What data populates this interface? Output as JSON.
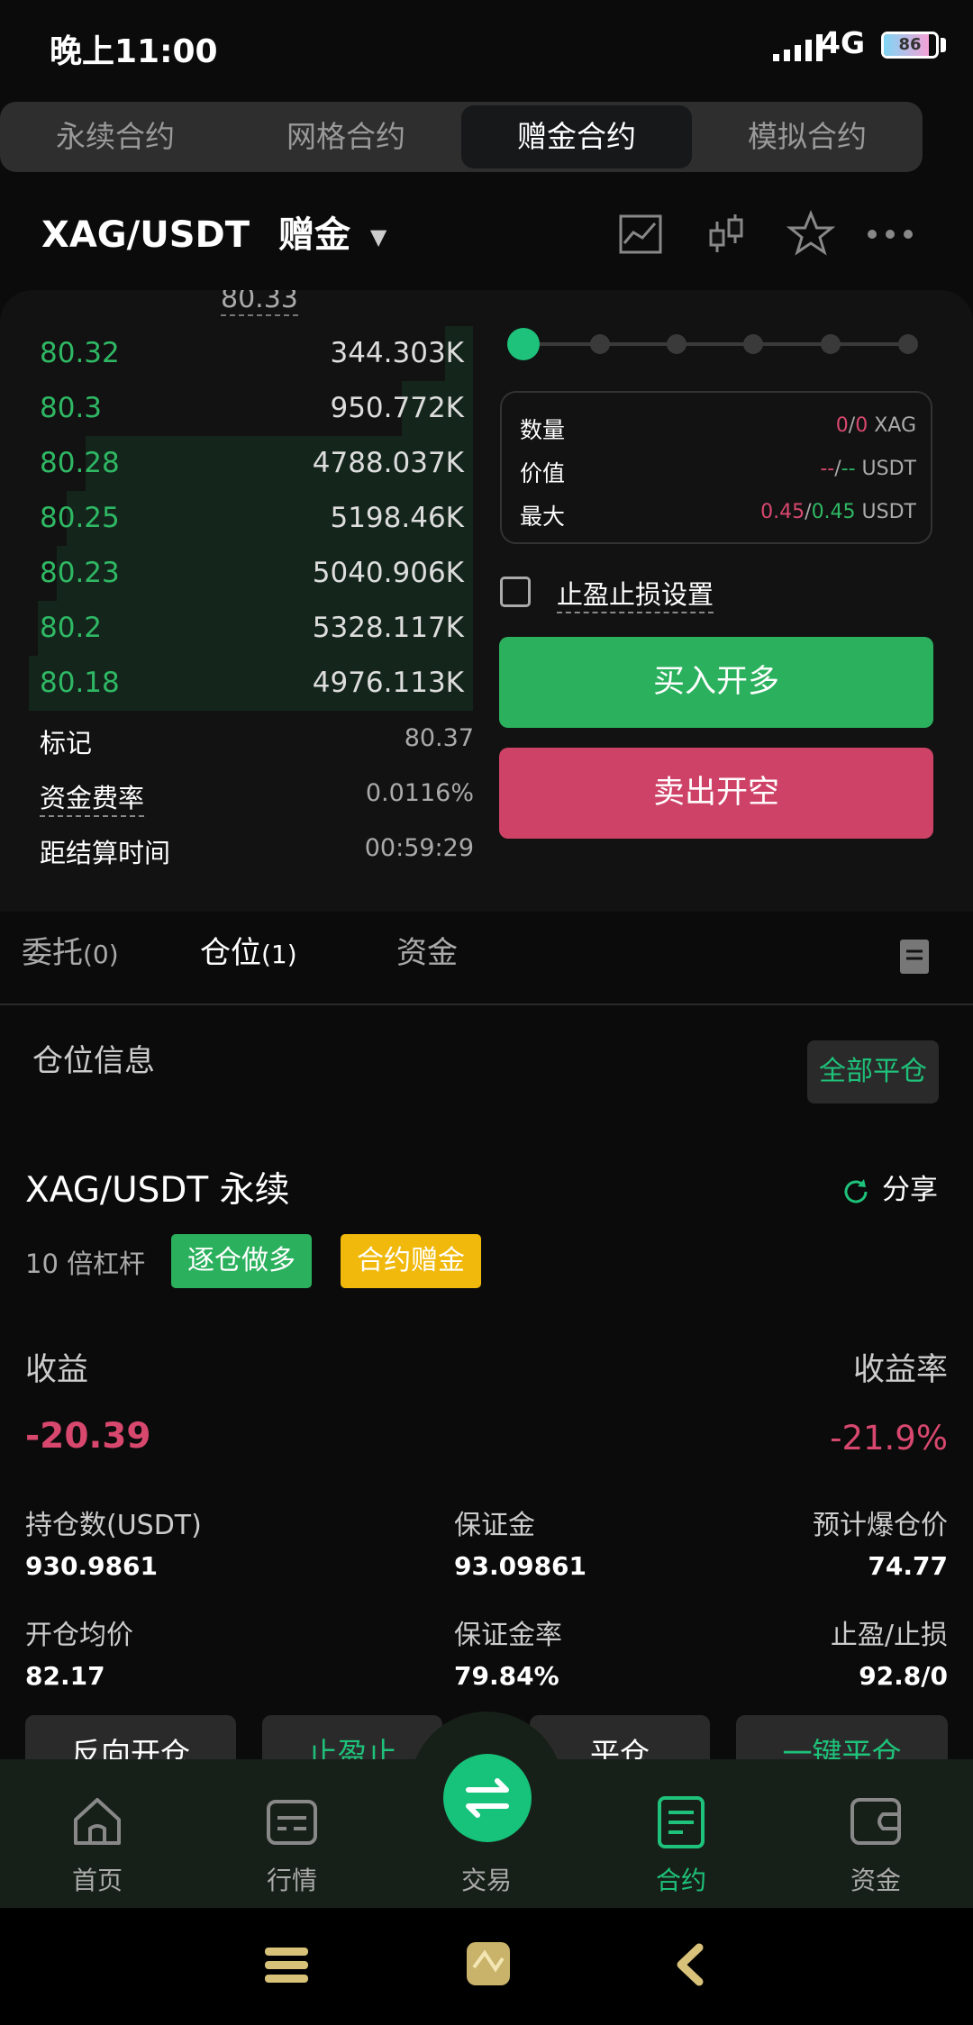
{
  "status_bar": {
    "time": "晚上11:00",
    "network": "4G",
    "battery": "86",
    "battery_level": 0.86
  },
  "top_tabs": [
    "永续合约",
    "网格合约",
    "赠金合约",
    "模拟合约"
  ],
  "active_top_tab": 2,
  "pair": {
    "symbol": "XAG/USDT",
    "badge": "赠金"
  },
  "orderbook": {
    "top_price": "80.33",
    "bids": [
      {
        "price": "80.32",
        "qty": "344.303K",
        "depth": 0.06
      },
      {
        "price": "80.3",
        "qty": "950.772K",
        "depth": 0.15
      },
      {
        "price": "80.28",
        "qty": "4788.037K",
        "depth": 0.82
      },
      {
        "price": "80.25",
        "qty": "5198.46K",
        "depth": 0.86
      },
      {
        "price": "80.23",
        "qty": "5040.906K",
        "depth": 0.88
      },
      {
        "price": "80.2",
        "qty": "5328.117K",
        "depth": 0.92
      },
      {
        "price": "80.18",
        "qty": "4976.113K",
        "depth": 0.94
      }
    ],
    "mark_label": "标记",
    "mark_value": "80.37",
    "funding_label": "资金费率",
    "funding_value": "0.0116%",
    "settle_label": "距结算时间",
    "settle_value": "00:59:29"
  },
  "order_form": {
    "qty_label": "数量",
    "qty_a": "0",
    "qty_sep": "/",
    "qty_b": "0",
    "qty_unit": "XAG",
    "value_label": "价值",
    "value_a": "--",
    "value_sep": "/",
    "value_b": "--",
    "value_unit": "USDT",
    "max_label": "最大",
    "max_a": "0.45",
    "max_sep": "/",
    "max_b": "0.45",
    "max_unit": "USDT",
    "tpsl_label": "止盈止损设置",
    "buy_label": "买入开多",
    "sell_label": "卖出开空"
  },
  "order_tabs": [
    {
      "label": "委托",
      "count": "(0)"
    },
    {
      "label": "仓位",
      "count": "(1)"
    },
    {
      "label": "资金",
      "count": ""
    }
  ],
  "position": {
    "section_title": "仓位信息",
    "close_all": "全部平仓",
    "symbol": "XAG/USDT 永续",
    "share": "分享",
    "leverage": "10 倍杠杆",
    "tag_side": "逐仓做多",
    "tag_bonus": "合约赠金",
    "pnl_label": "收益",
    "pnl_value": "-20.39",
    "roe_label": "收益率",
    "roe_value": "-21.9%",
    "size_label": "持仓数(USDT)",
    "size_value": "930.9861",
    "margin_label": "保证金",
    "margin_value": "93.09861",
    "liq_label": "预计爆仓价",
    "liq_value": "74.77",
    "entry_label": "开仓均价",
    "entry_value": "82.17",
    "mratio_label": "保证金率",
    "mratio_value": "79.84%",
    "tpsl_label": "止盈/止损",
    "tpsl_value": "92.8/0",
    "actions": [
      "反向开仓",
      "止盈止",
      "平仓",
      "一键平仓"
    ]
  },
  "bottom_nav": [
    {
      "label": "首页",
      "icon": "home-icon"
    },
    {
      "label": "行情",
      "icon": "market-icon"
    },
    {
      "label": "交易",
      "icon": "trade-swap-icon"
    },
    {
      "label": "合约",
      "icon": "contract-icon"
    },
    {
      "label": "资金",
      "icon": "wallet-icon"
    }
  ],
  "colors": {
    "green": "#2bb15d",
    "red": "#cf4267",
    "accent": "#1ec27a",
    "yellow": "#f0b90b"
  }
}
